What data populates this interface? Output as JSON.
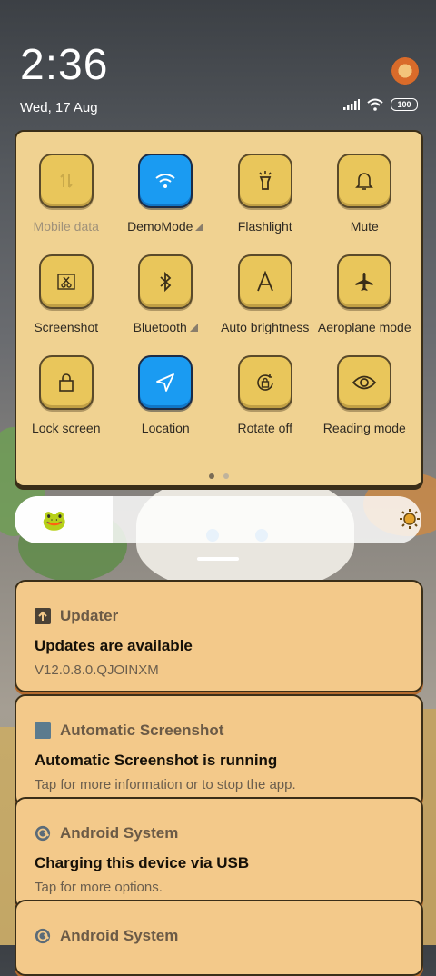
{
  "status": {
    "time": "2:36",
    "date": "Wed, 17 Aug",
    "battery": "100"
  },
  "tiles": [
    {
      "label": "Mobile data",
      "icon": "mobile-data-icon",
      "state": "disabled",
      "more": false
    },
    {
      "label": "DemoMode",
      "icon": "wifi-icon",
      "state": "on",
      "more": true
    },
    {
      "label": "Flashlight",
      "icon": "flashlight-icon",
      "state": "off",
      "more": false
    },
    {
      "label": "Mute",
      "icon": "bell-icon",
      "state": "off",
      "more": false
    },
    {
      "label": "Screenshot",
      "icon": "scissors-icon",
      "state": "off",
      "more": false
    },
    {
      "label": "Bluetooth",
      "icon": "bluetooth-icon",
      "state": "off",
      "more": true
    },
    {
      "label": "Auto brightness",
      "icon": "auto-brightness-icon",
      "state": "off",
      "more": false
    },
    {
      "label": "Aeroplane mode",
      "icon": "airplane-icon",
      "state": "off",
      "more": false
    },
    {
      "label": "Lock screen",
      "icon": "lock-icon",
      "state": "off",
      "more": false
    },
    {
      "label": "Location",
      "icon": "location-icon",
      "state": "on",
      "more": false
    },
    {
      "label": "Rotate off",
      "icon": "rotate-lock-icon",
      "state": "off",
      "more": false
    },
    {
      "label": "Reading mode",
      "icon": "eye-icon",
      "state": "off",
      "more": false
    }
  ],
  "pager": {
    "pages": 2,
    "current": 1
  },
  "brightness": {
    "level": 0.2
  },
  "notifications": [
    {
      "app": "Updater",
      "icon": "update-arrow-icon",
      "title": "Updates are available",
      "text": "V12.0.8.0.QJOINXM"
    },
    {
      "app": "Automatic Screenshot",
      "icon": "app-square-icon",
      "title": "Automatic Screenshot is running",
      "text": "Tap for more information or to stop the app."
    },
    {
      "app": "Android System",
      "icon": "android-system-icon",
      "title": "Charging this device via USB",
      "text": "Tap for more options."
    },
    {
      "app": "Android System",
      "icon": "android-system-icon",
      "title": "",
      "text": ""
    }
  ],
  "colors": {
    "panel": "#f0d291",
    "tile_off": "#e9c65b",
    "tile_on": "#1a9bf2",
    "notification": "#f3c98a"
  }
}
